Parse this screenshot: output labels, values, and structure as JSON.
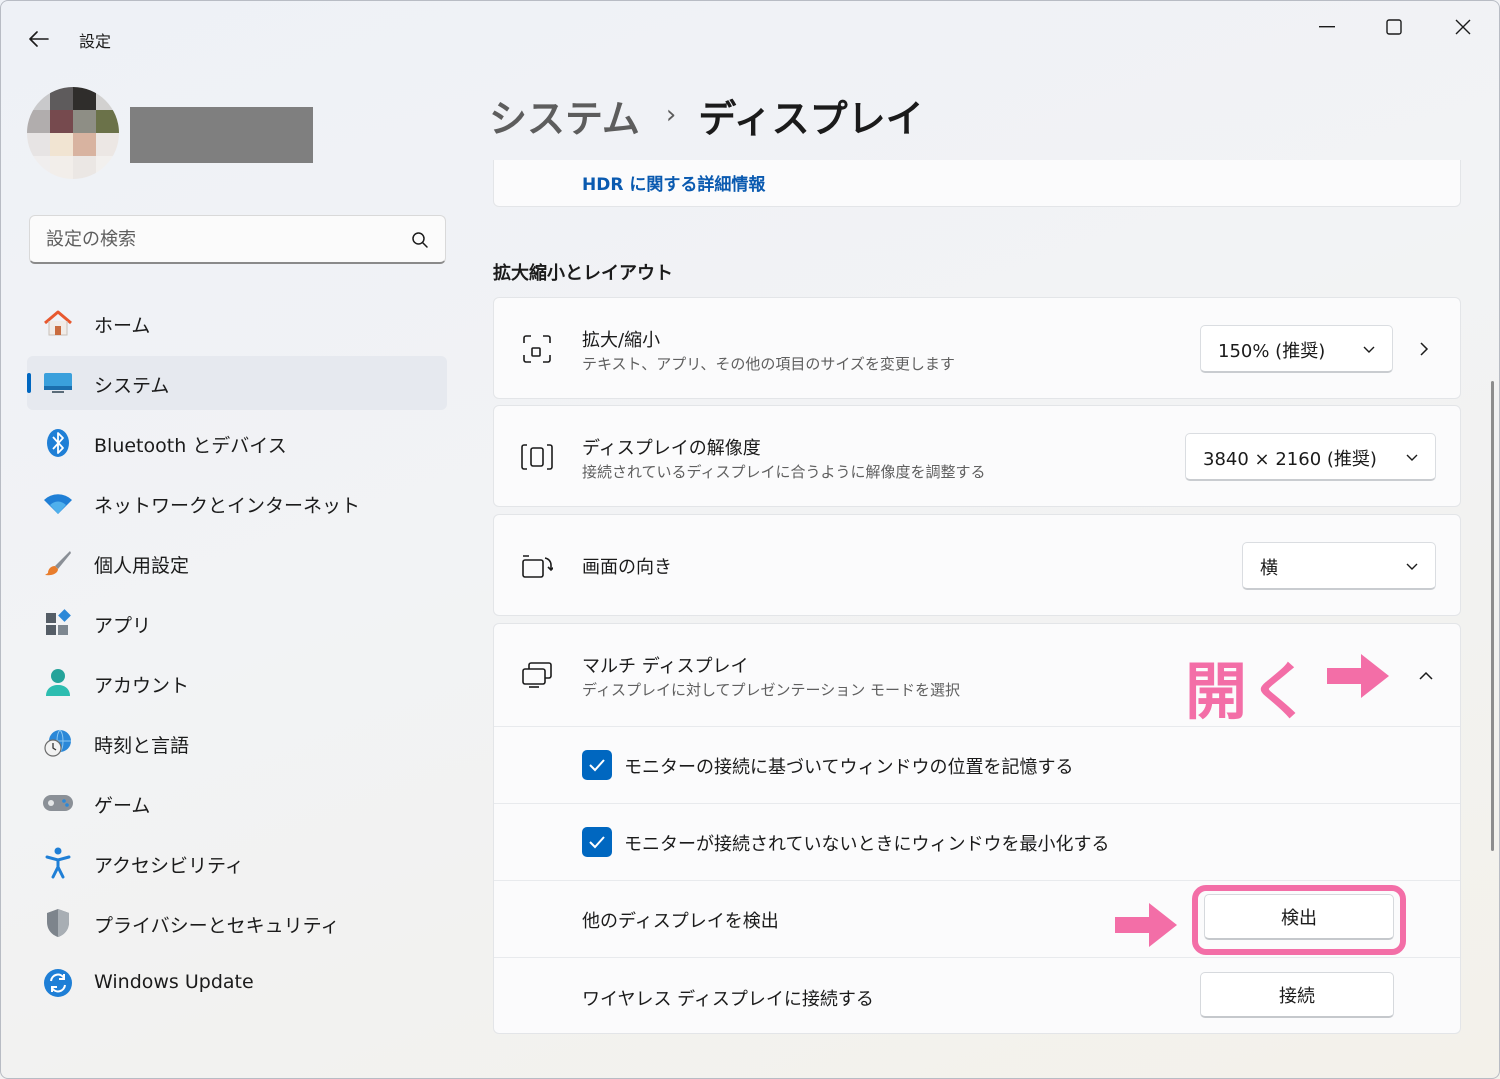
{
  "window": {
    "title": "設定",
    "controls": [
      "minimize",
      "maximize",
      "close"
    ]
  },
  "user": {
    "name_redacted": true
  },
  "search": {
    "placeholder": "設定の検索"
  },
  "sidebar": {
    "items": [
      {
        "label": "ホーム",
        "icon": "home-icon",
        "active": false
      },
      {
        "label": "システム",
        "icon": "system-display-icon",
        "active": true
      },
      {
        "label": "Bluetooth とデバイス",
        "icon": "bluetooth-icon",
        "active": false
      },
      {
        "label": "ネットワークとインターネット",
        "icon": "wifi-icon",
        "active": false
      },
      {
        "label": "個人用設定",
        "icon": "paintbrush-icon",
        "active": false
      },
      {
        "label": "アプリ",
        "icon": "apps-icon",
        "active": false
      },
      {
        "label": "アカウント",
        "icon": "account-icon",
        "active": false
      },
      {
        "label": "時刻と言語",
        "icon": "clock-globe-icon",
        "active": false
      },
      {
        "label": "ゲーム",
        "icon": "gamepad-icon",
        "active": false
      },
      {
        "label": "アクセシビリティ",
        "icon": "accessibility-icon",
        "active": false
      },
      {
        "label": "プライバシーとセキュリティ",
        "icon": "shield-icon",
        "active": false
      },
      {
        "label": "Windows Update",
        "icon": "windows-update-icon",
        "active": false
      }
    ]
  },
  "header": {
    "parent": "システム",
    "separator": "›",
    "current": "ディスプレイ"
  },
  "hdr": {
    "link": "HDR に関する詳細情報"
  },
  "scale_layout": {
    "section_title": "拡大縮小とレイアウト",
    "scale": {
      "title": "拡大/縮小",
      "subtitle": "テキスト、アプリ、その他の項目のサイズを変更します",
      "value": "150% (推奨)"
    },
    "resolution": {
      "title": "ディスプレイの解像度",
      "subtitle": "接続されているディスプレイに合うように解像度を調整する",
      "value": "3840 × 2160 (推奨)"
    },
    "orientation": {
      "title": "画面の向き",
      "value": "横"
    },
    "multi_display": {
      "title": "マルチ ディスプレイ",
      "subtitle": "ディスプレイに対してプレゼンテーション モードを選択",
      "expanded": true,
      "options": [
        {
          "label": "モニターの接続に基づいてウィンドウの位置を記憶する",
          "checked": true
        },
        {
          "label": "モニターが接続されていないときにウィンドウを最小化する",
          "checked": true
        }
      ],
      "detect": {
        "label": "他のディスプレイを検出",
        "button": "検出"
      },
      "wireless": {
        "label": "ワイヤレス ディスプレイに接続する",
        "button": "接続"
      }
    }
  },
  "annotations": {
    "open_text": "開く",
    "color": "#f36ea7"
  },
  "colors": {
    "accent": "#0067c0",
    "link": "#0a5ab0",
    "annotation": "#f36ea7"
  }
}
